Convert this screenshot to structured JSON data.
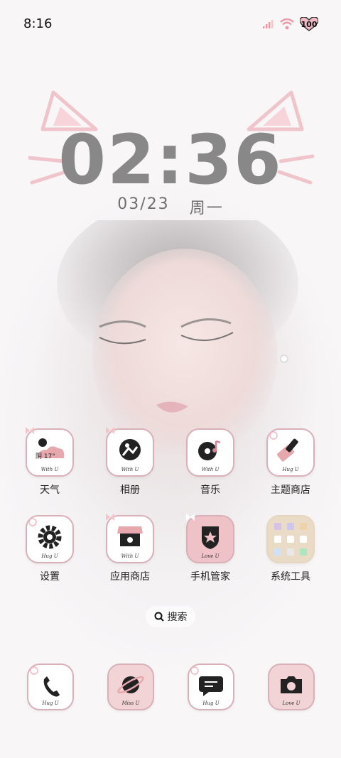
{
  "status_bar": {
    "time": "8:16",
    "battery": "100"
  },
  "clock_widget": {
    "time": "02:36",
    "date": "03/23",
    "weekday": "周一"
  },
  "apps": [
    {
      "name": "天气",
      "icon": "weather-icon",
      "weather_text": "阴 17°",
      "signature": "With U"
    },
    {
      "name": "相册",
      "icon": "gallery-icon",
      "signature": "With U"
    },
    {
      "name": "音乐",
      "icon": "music-icon",
      "signature": "With U"
    },
    {
      "name": "主题商店",
      "icon": "theme-brush-icon",
      "signature": "Hug U"
    },
    {
      "name": "设置",
      "icon": "gear-icon",
      "signature": "Hug U"
    },
    {
      "name": "应用商店",
      "icon": "store-icon",
      "signature": "With U"
    },
    {
      "name": "手机管家",
      "icon": "shield-star-icon",
      "signature": "Love U"
    },
    {
      "name": "系统工具",
      "icon": "folder-icon"
    }
  ],
  "search": {
    "label": "搜索"
  },
  "dock": [
    {
      "icon": "phone-icon",
      "signature": "Hug U"
    },
    {
      "icon": "planet-icon",
      "signature": "Miss U"
    },
    {
      "icon": "message-icon",
      "signature": "Hug U"
    },
    {
      "icon": "camera-icon",
      "signature": "Love U"
    }
  ],
  "colors": {
    "accent_pink": "#e7b7bd",
    "icon_border": "#d9b0b8",
    "clock_gray": "#888888"
  }
}
